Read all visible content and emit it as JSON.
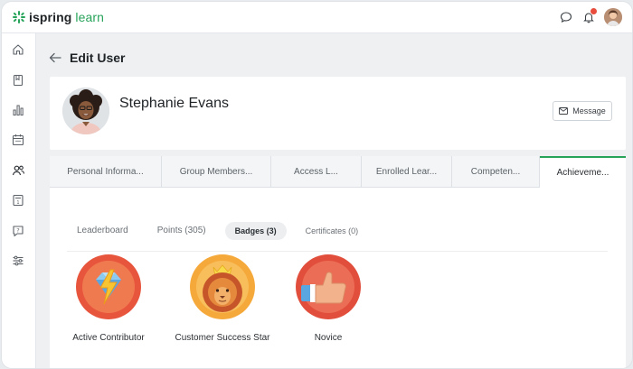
{
  "app": {
    "logo_brand": "ispring",
    "logo_product": "learn",
    "accent_color": "#27a35a",
    "notification_dot_color": "#e74c3c"
  },
  "topbar": {
    "icons": [
      "chat-icon",
      "bell-icon",
      "user-avatar"
    ]
  },
  "sidebar": {
    "items": [
      {
        "icon": "home-icon"
      },
      {
        "icon": "book-icon"
      },
      {
        "icon": "bar-chart-icon"
      },
      {
        "icon": "calendar-icon"
      },
      {
        "icon": "users-icon"
      },
      {
        "icon": "certificate-icon"
      },
      {
        "icon": "help-icon"
      },
      {
        "icon": "sliders-icon"
      }
    ]
  },
  "page": {
    "title": "Edit User"
  },
  "profile": {
    "name": "Stephanie Evans",
    "message_label": "Message"
  },
  "tabs": [
    {
      "label": "Personal Informa...",
      "active": false
    },
    {
      "label": "Group Members...",
      "active": false
    },
    {
      "label": "Access L...",
      "active": false
    },
    {
      "label": "Enrolled Lear...",
      "active": false
    },
    {
      "label": "Competen...",
      "active": false
    },
    {
      "label": "Achieveme...",
      "active": true
    }
  ],
  "subtabs": [
    {
      "label": "Leaderboard",
      "active": false
    },
    {
      "label": "Points (305)",
      "active": false
    },
    {
      "label": "Badges (3)",
      "active": true
    },
    {
      "label": "Certificates (0)",
      "active": false
    }
  ],
  "badges": [
    {
      "label": "Active Contributor",
      "icon": "lightning-badge-icon"
    },
    {
      "label": "Customer Success Star",
      "icon": "lion-badge-icon"
    },
    {
      "label": "Novice",
      "icon": "thumbs-up-badge-icon"
    }
  ]
}
